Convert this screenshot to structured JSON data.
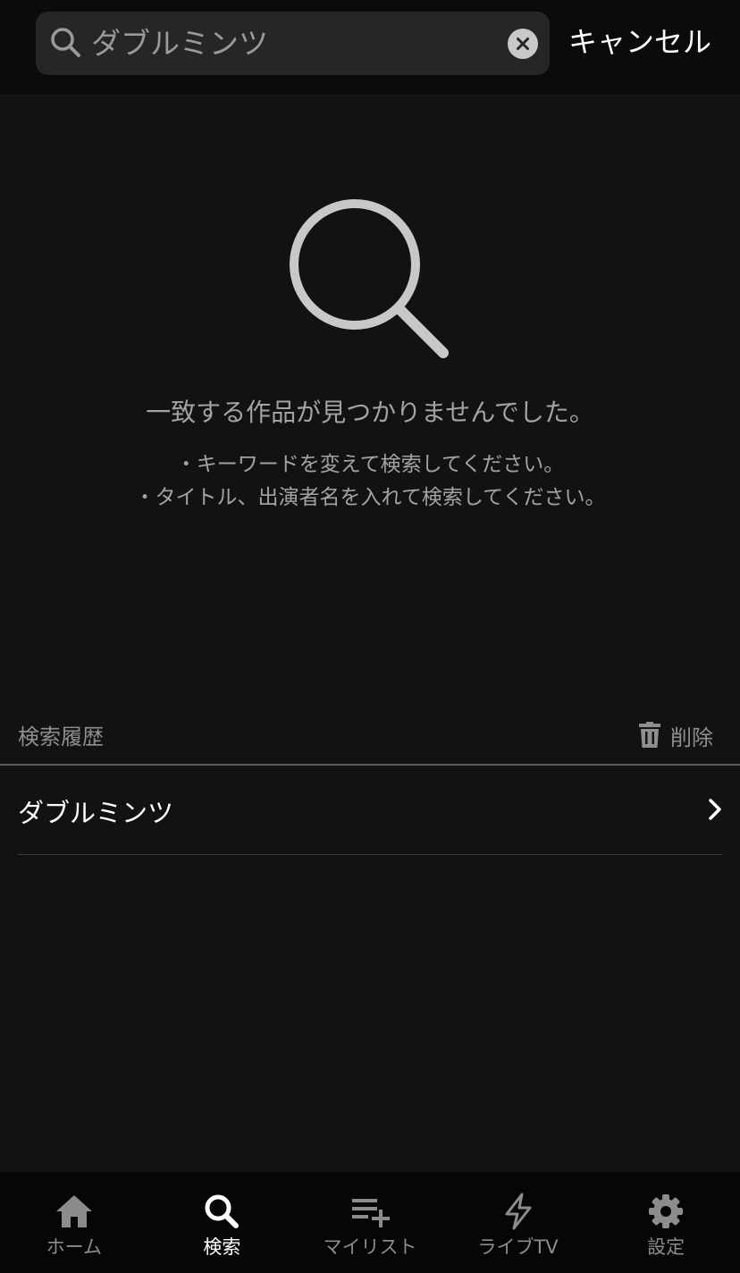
{
  "search": {
    "placeholder": "ダブルミンツ",
    "value": "",
    "cancel_label": "キャンセル"
  },
  "empty_state": {
    "title": "一致する作品が見つかりませんでした。",
    "hints": [
      "・キーワードを変えて検索してください。",
      "・タイトル、出演者名を入れて検索してください。"
    ]
  },
  "history": {
    "title": "検索履歴",
    "delete_label": "削除",
    "items": [
      {
        "label": "ダブルミンツ"
      }
    ]
  },
  "tabs": [
    {
      "label": "ホーム",
      "icon": "home-icon",
      "active": false
    },
    {
      "label": "検索",
      "icon": "search-icon",
      "active": true
    },
    {
      "label": "マイリスト",
      "icon": "playlist-add-icon",
      "active": false
    },
    {
      "label": "ライブTV",
      "icon": "lightning-icon",
      "active": false
    },
    {
      "label": "設定",
      "icon": "gear-icon",
      "active": false
    }
  ],
  "colors": {
    "background": "#111212",
    "topbar": "#0b0b0b",
    "search_field": "#252625",
    "tabbar": "#060606",
    "muted_text": "#a3a3a3",
    "inactive_tab": "#8c8c8c",
    "active_tab": "#ffffff"
  }
}
